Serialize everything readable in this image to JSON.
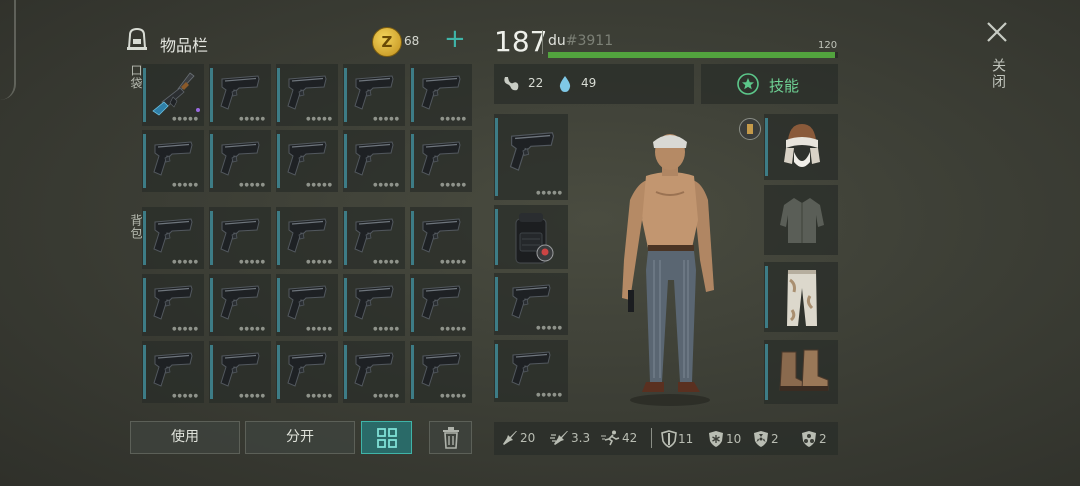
{
  "inventory": {
    "title": "物品栏",
    "coin_symbol": "Z",
    "coins": "68",
    "add_label": "+",
    "pockets_label": "口袋",
    "backpack_label": "背包"
  },
  "actions": {
    "use_label": "使用",
    "split_label": "分开"
  },
  "player": {
    "level": "187",
    "name": "du",
    "tag": "#3911",
    "xp_value": "120",
    "xp_fraction": 0.99
  },
  "needs": {
    "food": "22",
    "water": "49"
  },
  "skills_label": "技能",
  "stats": {
    "attack": "20",
    "attack_speed": "3.3",
    "speed": "42",
    "armor": "11",
    "cold": "10",
    "radiation": "2",
    "toxic": "2"
  },
  "close_label": "关闭",
  "pocket_items": [
    "ak47-rifle-icon",
    "pistol-icon",
    "pistol-icon",
    "pistol-icon",
    "pistol-icon",
    "pistol-icon",
    "pistol-icon",
    "pistol-icon",
    "pistol-icon",
    "pistol-icon"
  ],
  "backpack_items": [
    "pistol-icon",
    "pistol-icon",
    "pistol-icon",
    "pistol-icon",
    "pistol-icon",
    "pistol-icon",
    "pistol-icon",
    "pistol-icon",
    "pistol-icon",
    "pistol-icon",
    "pistol-icon",
    "pistol-icon",
    "pistol-icon",
    "pistol-icon",
    "pistol-icon"
  ],
  "equipment": {
    "weapon": "pistol-icon",
    "backpack": "tactical-backpack-icon",
    "quick_slot_1": "pistol-icon",
    "quick_slot_2": "pistol-icon",
    "head": "ushanka-hat-icon",
    "torso": "empty-jacket-icon",
    "legs": "camo-pants-icon",
    "feet": "boots-icon"
  },
  "colors": {
    "accent_teal": "#3fb4a8",
    "xp_green": "#52a33e",
    "slot_bar": "#3d7c86",
    "rarity_purple": "#9a6ae0"
  }
}
